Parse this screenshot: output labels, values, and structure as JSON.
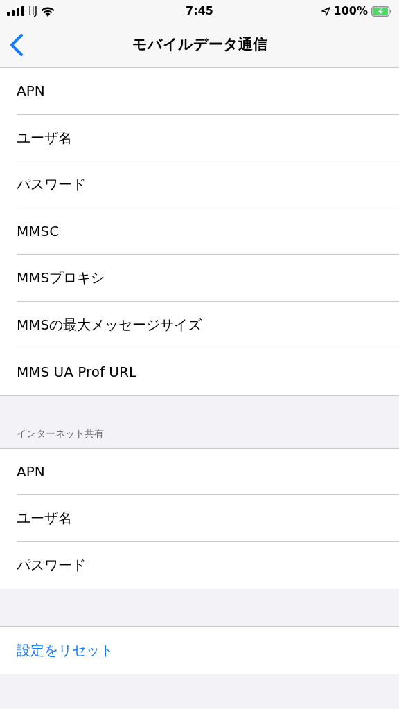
{
  "status_bar": {
    "carrier": "IIJ",
    "time": "7:45",
    "battery": "100%",
    "charging": true
  },
  "nav": {
    "title": "モバイルデータ通信"
  },
  "sections": [
    {
      "rows": [
        {
          "label": "APN"
        },
        {
          "label": "ユーザ名"
        },
        {
          "label": "パスワード"
        },
        {
          "label": "MMSC"
        },
        {
          "label": "MMSプロキシ"
        },
        {
          "label": "MMSの最大メッセージサイズ"
        },
        {
          "label": "MMS UA Prof URL"
        }
      ]
    },
    {
      "header": "インターネット共有",
      "rows": [
        {
          "label": "APN"
        },
        {
          "label": "ユーザ名"
        },
        {
          "label": "パスワード"
        }
      ]
    },
    {
      "rows": [
        {
          "label": "設定をリセット",
          "kind": "action"
        }
      ]
    }
  ]
}
